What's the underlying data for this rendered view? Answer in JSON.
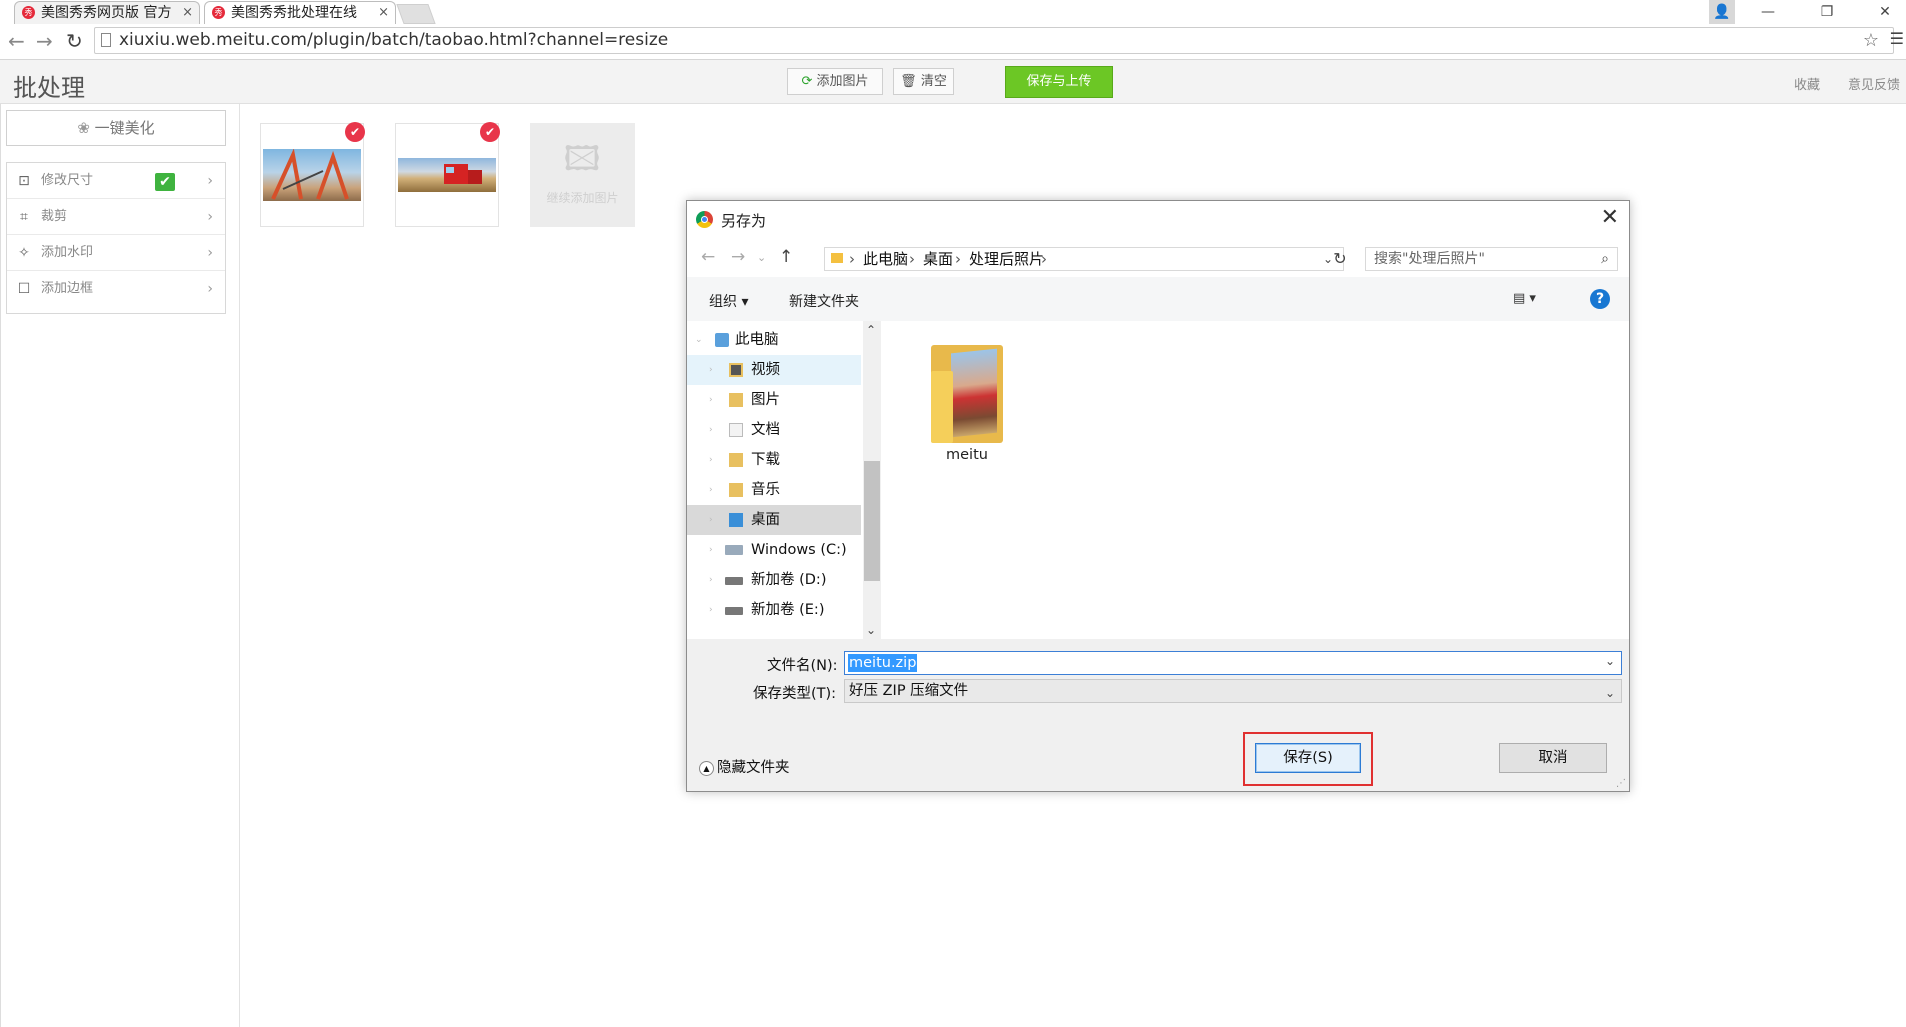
{
  "browser": {
    "tabs": [
      {
        "title": "美图秀秀网页版 官方",
        "fav": "秀"
      },
      {
        "title": "美图秀秀批处理在线",
        "fav": "秀"
      }
    ],
    "url": "xiuxiu.web.meitu.com/plugin/batch/taobao.html?channel=resize",
    "close_glyph": "×"
  },
  "app": {
    "title": "批处理",
    "toolbar": {
      "add_image": "添加图片",
      "clear": "清空",
      "save_upload": "保存与上传"
    },
    "links": {
      "favorite": "收藏",
      "feedback": "意见反馈"
    },
    "sidebar": {
      "beautify": "一键美化",
      "tools": [
        {
          "label": "修改尺寸",
          "icon": "resize-icon",
          "checked": true
        },
        {
          "label": "裁剪",
          "icon": "crop-icon",
          "checked": false
        },
        {
          "label": "添加水印",
          "icon": "watermark-icon",
          "checked": false
        },
        {
          "label": "添加边框",
          "icon": "border-icon",
          "checked": false
        }
      ]
    },
    "add_more_label": "继续添加图片"
  },
  "dialog": {
    "title": "另存为",
    "breadcrumb": [
      "此电脑",
      "桌面",
      "处理后照片"
    ],
    "search_placeholder": "搜索\"处理后照片\"",
    "commands": {
      "organize": "组织 ▾",
      "new_folder": "新建文件夹"
    },
    "nav": [
      {
        "label": "此电脑",
        "level": 0
      },
      {
        "label": "视频",
        "level": 1
      },
      {
        "label": "图片",
        "level": 1
      },
      {
        "label": "文档",
        "level": 1
      },
      {
        "label": "下载",
        "level": 1
      },
      {
        "label": "音乐",
        "level": 1
      },
      {
        "label": "桌面",
        "level": 1
      },
      {
        "label": "Windows (C:)",
        "level": 1
      },
      {
        "label": "新加卷 (D:)",
        "level": 1
      },
      {
        "label": "新加卷 (E:)",
        "level": 1
      }
    ],
    "selected_nav": "桌面",
    "folder_name": "meitu",
    "filename_label": "文件名(N):",
    "filename_value": "meitu.zip",
    "filetype_label": "保存类型(T):",
    "filetype_value": "好压 ZIP 压缩文件",
    "hide_folders": "隐藏文件夹",
    "save": "保存(S)",
    "cancel": "取消"
  },
  "colors": {
    "accent_green": "#6cc725",
    "dialog_blue": "#1877d2",
    "highlight_red": "#e03030"
  }
}
